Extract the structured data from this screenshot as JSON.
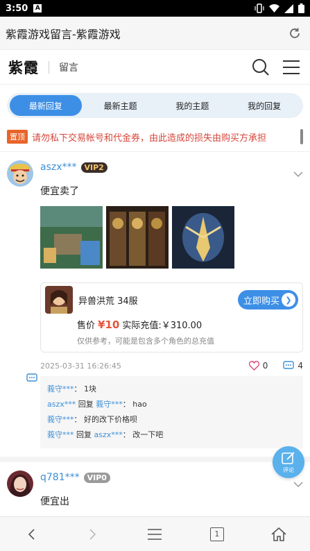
{
  "status_bar": {
    "time": "3:50",
    "notification_letter": "A"
  },
  "browser": {
    "page_title": "紫霞游戏留言-紫霞游戏"
  },
  "header": {
    "logo": "紫霞",
    "section": "留言"
  },
  "tabs": [
    {
      "label": "最新回复",
      "active": true
    },
    {
      "label": "最新主题",
      "active": false
    },
    {
      "label": "我的主题",
      "active": false
    },
    {
      "label": "我的回复",
      "active": false
    }
  ],
  "notice": {
    "badge": "置顶",
    "text": "请勿私下交易帐号和代金券，由此造成的损失由购买方承担"
  },
  "posts": [
    {
      "username": "aszx***",
      "vip": "VIP2",
      "content": "便宜卖了",
      "product": {
        "name": "异兽洪荒 34服",
        "buy_label": "立即购买",
        "price_label": "售价",
        "price": "¥10",
        "recharge": "实际充值:￥310.00",
        "note": "仅供参考，可能是包含多个角色的总充值"
      },
      "date": "2025-03-31 16:26:45",
      "likes": "0",
      "comments_count": "4",
      "comments": [
        {
          "user": "莪守***",
          "reply_word": "",
          "reply_to": "",
          "sep": "：",
          "text": "1块"
        },
        {
          "user": "aszx***",
          "reply_word": "回复",
          "reply_to": "莪守***",
          "sep": "：",
          "text": "hao"
        },
        {
          "user": "莪守***",
          "reply_word": "",
          "reply_to": "",
          "sep": "：",
          "text": "好的改下价格呗"
        },
        {
          "user": "莪守***",
          "reply_word": "回复",
          "reply_to": "aszx***",
          "sep": "：",
          "text": "改一下吧"
        }
      ]
    },
    {
      "username": "q781***",
      "vip": "VIP0",
      "content": "便宜出"
    }
  ],
  "fab": {
    "label": "评论"
  },
  "bottom_nav": {
    "tab_count": "1"
  },
  "colors": {
    "accent": "#3d8fe6",
    "username": "#3d8fd6",
    "notice": "#d6453a",
    "price": "#e8533a"
  }
}
